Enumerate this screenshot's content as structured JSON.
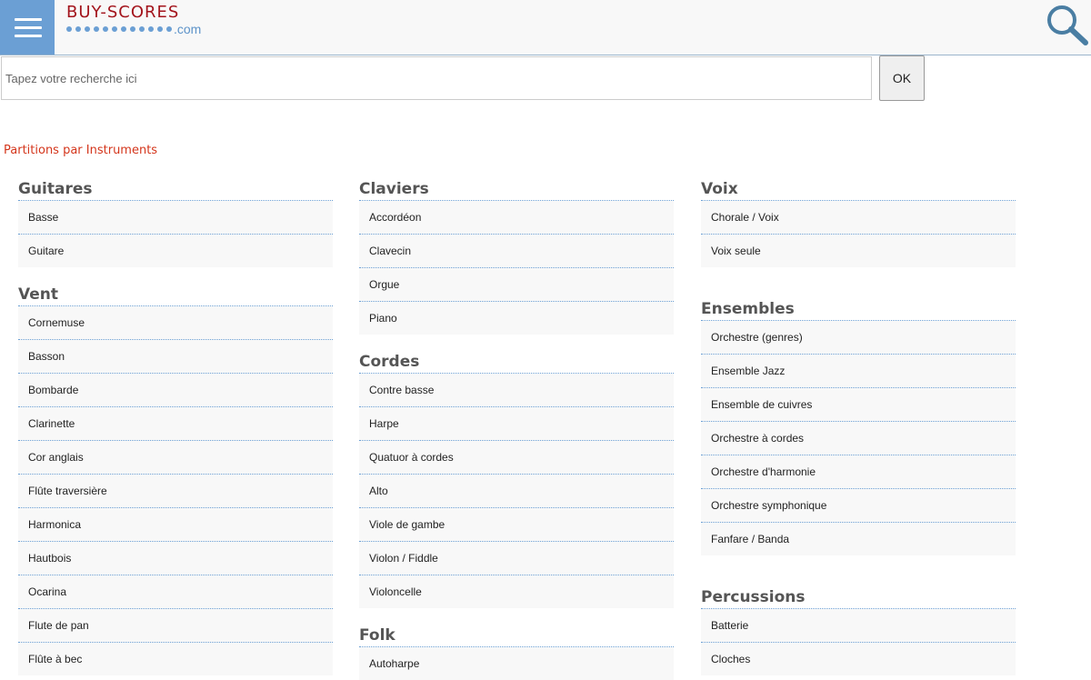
{
  "header": {
    "logo_name": "BUY-SCORES",
    "logo_tld": ".com",
    "accent_color": "#6b9fd4",
    "brand_color": "#a3141c"
  },
  "search": {
    "placeholder": "Tapez votre recherche ici",
    "value": "",
    "button_label": "OK"
  },
  "page_title": "Partitions par Instruments",
  "categories": {
    "guitares": {
      "title": "Guitares",
      "items": [
        "Basse",
        "Guitare"
      ]
    },
    "vent": {
      "title": "Vent",
      "items": [
        "Cornemuse",
        "Basson",
        "Bombarde",
        "Clarinette",
        "Cor anglais",
        "Flûte traversière",
        "Harmonica",
        "Hautbois",
        "Ocarina",
        "Flute de pan",
        "Flûte à bec"
      ]
    },
    "claviers": {
      "title": "Claviers",
      "items": [
        "Accordéon",
        "Clavecin",
        "Orgue",
        "Piano"
      ]
    },
    "cordes": {
      "title": "Cordes",
      "items": [
        "Contre basse",
        "Harpe",
        "Quatuor à cordes",
        "Alto",
        "Viole de gambe",
        "Violon / Fiddle",
        "Violoncelle"
      ]
    },
    "folk": {
      "title": "Folk",
      "items": [
        "Autoharpe"
      ]
    },
    "voix": {
      "title": "Voix",
      "items": [
        "Chorale / Voix",
        "Voix seule"
      ]
    },
    "ensembles": {
      "title": "Ensembles",
      "items": [
        "Orchestre (genres)",
        "Ensemble Jazz",
        "Ensemble de cuivres",
        "Orchestre à cordes",
        "Orchestre d'harmonie",
        "Orchestre symphonique",
        "Fanfare / Banda"
      ]
    },
    "percussions": {
      "title": "Percussions",
      "items": [
        "Batterie",
        "Cloches"
      ]
    }
  }
}
